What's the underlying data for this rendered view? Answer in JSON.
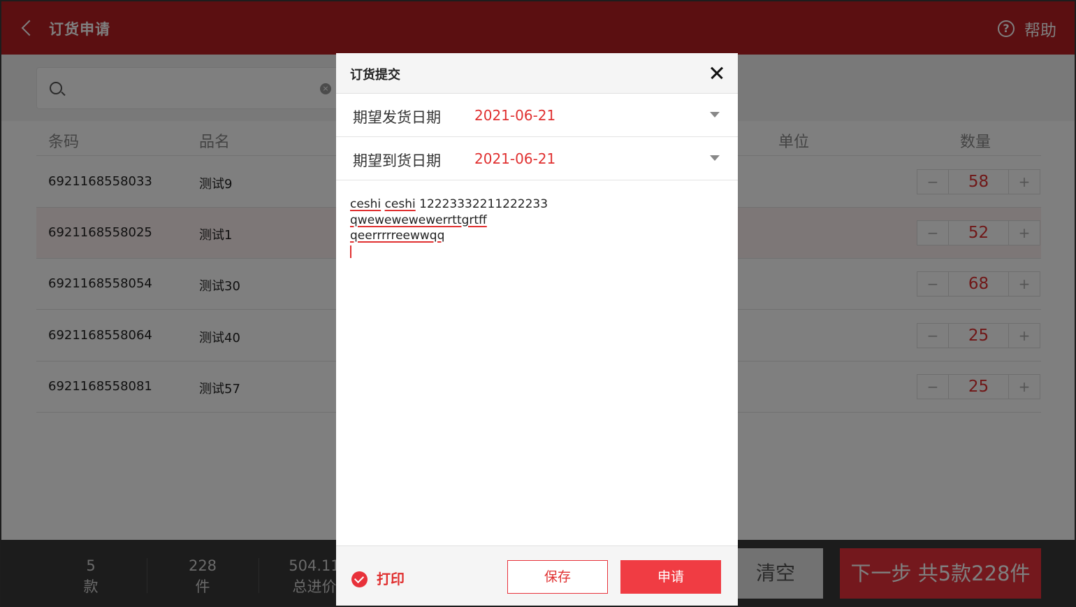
{
  "header": {
    "title": "订货申请",
    "help_label": "帮助"
  },
  "search": {
    "clear_glyph": "×"
  },
  "table": {
    "columns": {
      "barcode": "条码",
      "name": "品名",
      "unit": "单位",
      "qty": "数量"
    },
    "rows": [
      {
        "barcode": "6921168558033",
        "name": "测试9",
        "qty": "58",
        "selected": false
      },
      {
        "barcode": "6921168558025",
        "name": "测试1",
        "qty": "52",
        "selected": true
      },
      {
        "barcode": "6921168558054",
        "name": "测试30",
        "qty": "68",
        "selected": false
      },
      {
        "barcode": "6921168558064",
        "name": "测试40",
        "qty": "25",
        "selected": false
      },
      {
        "barcode": "6921168558081",
        "name": "测试57",
        "qty": "25",
        "selected": false
      }
    ],
    "minus_label": "−",
    "plus_label": "+"
  },
  "footer": {
    "stats": [
      {
        "value": "5",
        "unit": "款"
      },
      {
        "value": "228",
        "unit": "件"
      },
      {
        "value": "504.11",
        "unit": "总进价"
      }
    ],
    "clear_label": "清空",
    "next_label": "下一步  共5款228件"
  },
  "dialog": {
    "title": "订货提交",
    "ship_date_label": "期望发货日期",
    "ship_date_value": "2021-06-21",
    "arrive_date_label": "期望到货日期",
    "arrive_date_value": "2021-06-21",
    "note_lines": [
      {
        "w1": "ceshi",
        "w2": "ceshi",
        "rest": " 12223332211222233"
      },
      {
        "w1": "qwewewewewerrttgrtff"
      },
      {
        "w1": "qeerrrrreewwqq"
      }
    ],
    "print_label": "打印",
    "save_label": "保存",
    "apply_label": "申请"
  },
  "colors": {
    "brand_red": "#e8313a",
    "header_red": "#b71f22"
  }
}
